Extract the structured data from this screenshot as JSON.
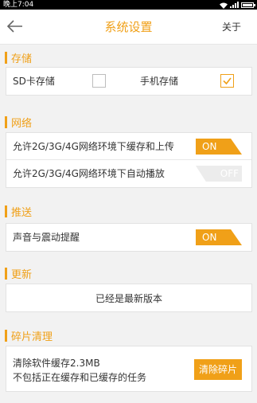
{
  "status_bar": {
    "time": "晚上7:04"
  },
  "app_bar": {
    "title": "系统设置",
    "about": "关于"
  },
  "sections": {
    "storage": {
      "title": "存储",
      "sd_label": "SD卡存储",
      "phone_label": "手机存储",
      "sd_checked": false,
      "phone_checked": true
    },
    "network": {
      "title": "网络",
      "cache_upload_label": "允许2G/3G/4G网络环境下缓存和上传",
      "cache_upload_toggle": "ON",
      "autoplay_label": "允许2G/3G/4G网络环境下自动播放",
      "autoplay_toggle": "OFF"
    },
    "push": {
      "title": "推送",
      "sound_label": "声音与震动提醒",
      "sound_toggle": "ON"
    },
    "update": {
      "title": "更新",
      "status": "已经是最新版本"
    },
    "cleanup": {
      "title": "碎片清理",
      "line1": "清除软件缓存2.3MB",
      "line2": "不包括正在缓存和已缓存的任务",
      "button": "清除碎片"
    }
  },
  "colors": {
    "accent": "#f0a018",
    "background": "#f2f2f2"
  },
  "icons": {
    "back": "arrow-left-icon",
    "check": "check-icon"
  }
}
